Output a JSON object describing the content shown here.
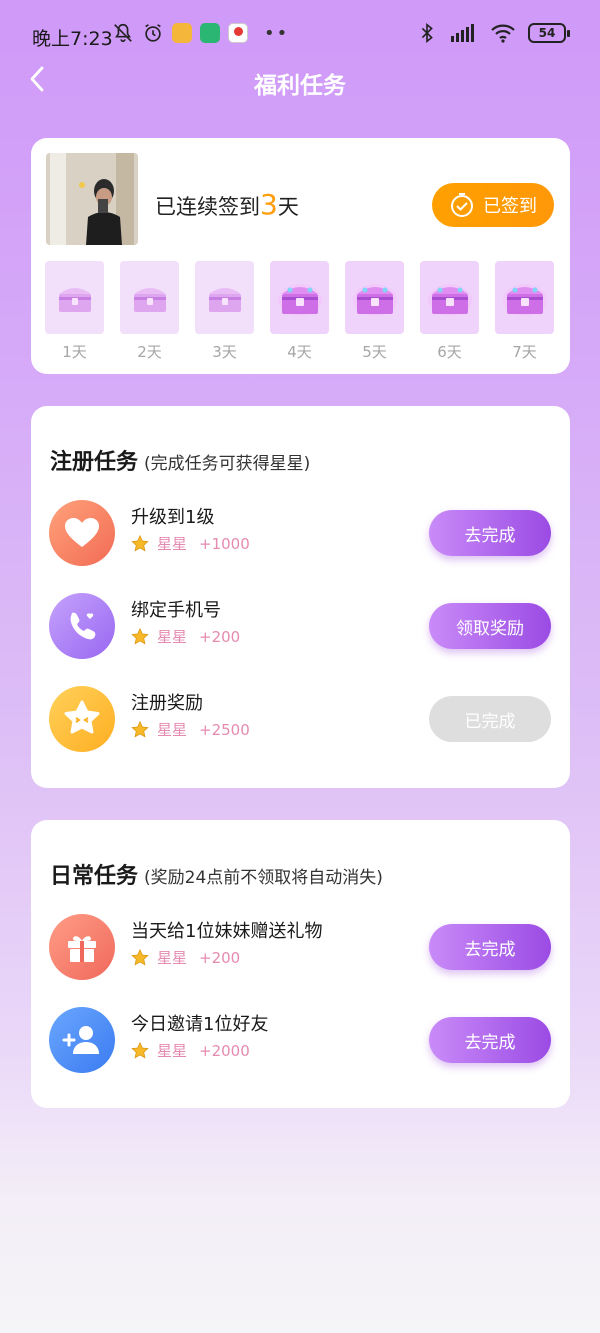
{
  "status_bar": {
    "time": "晚上7:23",
    "battery": "54",
    "icons": [
      "mute-icon",
      "alarm-icon",
      "notes-app-icon",
      "shield-app-icon",
      "map-app-icon",
      "bluetooth-icon",
      "signal-icon",
      "wifi-icon"
    ]
  },
  "header": {
    "title": "福利任务"
  },
  "checkin": {
    "text_prefix": "已连续签到",
    "days": "3",
    "text_suffix": "天",
    "button_label": "已签到",
    "day_labels": [
      "1天",
      "2天",
      "3天",
      "4天",
      "5天",
      "6天",
      "7天"
    ]
  },
  "register_section": {
    "title": "注册任务",
    "subtitle": "(完成任务可获得星星)",
    "tasks": [
      {
        "title": "升级到1级",
        "reward_label": "星星",
        "reward": "+1000",
        "button": "去完成",
        "status": "todo"
      },
      {
        "title": "绑定手机号",
        "reward_label": "星星",
        "reward": "+200",
        "button": "领取奖励",
        "status": "claim"
      },
      {
        "title": "注册奖励",
        "reward_label": "星星",
        "reward": "+2500",
        "button": "已完成",
        "status": "done"
      }
    ]
  },
  "daily_section": {
    "title": "日常任务",
    "subtitle": "(奖励24点前不领取将自动消失)",
    "tasks": [
      {
        "title": "当天给1位妹妹赠送礼物",
        "reward_label": "星星",
        "reward": "+200",
        "button": "去完成",
        "status": "todo"
      },
      {
        "title": "今日邀请1位好友",
        "reward_label": "星星",
        "reward": "+2000",
        "button": "去完成",
        "status": "todo"
      }
    ]
  },
  "colors": {
    "accent_orange": "#ff9d0a",
    "button_purple": "#a855e8",
    "reward_pink": "#e58ab0"
  }
}
